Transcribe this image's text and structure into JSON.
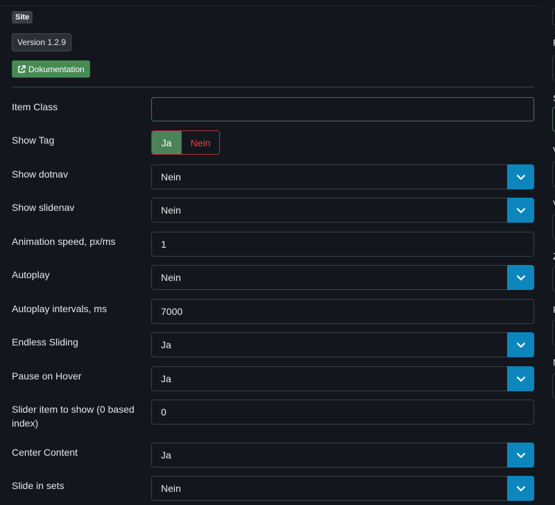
{
  "header": {
    "site_badge": "Site",
    "version_badge": "Version 1.2.9",
    "docs_button": "Dokumentation"
  },
  "fields": {
    "item_class": {
      "label": "Item Class",
      "value": ""
    },
    "show_tag": {
      "label": "Show Tag",
      "yes": "Ja",
      "no": "Nein",
      "selected": "Ja"
    },
    "show_dotnav": {
      "label": "Show dotnav",
      "value": "Nein"
    },
    "show_slidenav": {
      "label": "Show slidenav",
      "value": "Nein"
    },
    "animation_speed": {
      "label": "Animation speed, px/ms",
      "value": "1"
    },
    "autoplay": {
      "label": "Autoplay",
      "value": "Nein"
    },
    "autoplay_intervals": {
      "label": "Autoplay intervals, ms",
      "value": "7000"
    },
    "endless_sliding": {
      "label": "Endless Sliding",
      "value": "Ja"
    },
    "pause_on_hover": {
      "label": "Pause on Hover",
      "value": "Ja"
    },
    "slider_item_to_show": {
      "label": "Slider item to show (0 based index)",
      "value": "0"
    },
    "center_content": {
      "label": "Center Content",
      "value": "Ja"
    },
    "slide_in_sets": {
      "label": "Slide in sets",
      "value": "Nein"
    }
  },
  "right_panel": {
    "labels": [
      "P",
      "S",
      "V",
      "V",
      "Z",
      "F",
      "N"
    ]
  },
  "colors": {
    "background": "#13171d",
    "select_button": "#0d86be",
    "toggle_active": "#4b8359",
    "toggle_inactive_text": "#e0454e",
    "docs_button": "#468a54"
  }
}
